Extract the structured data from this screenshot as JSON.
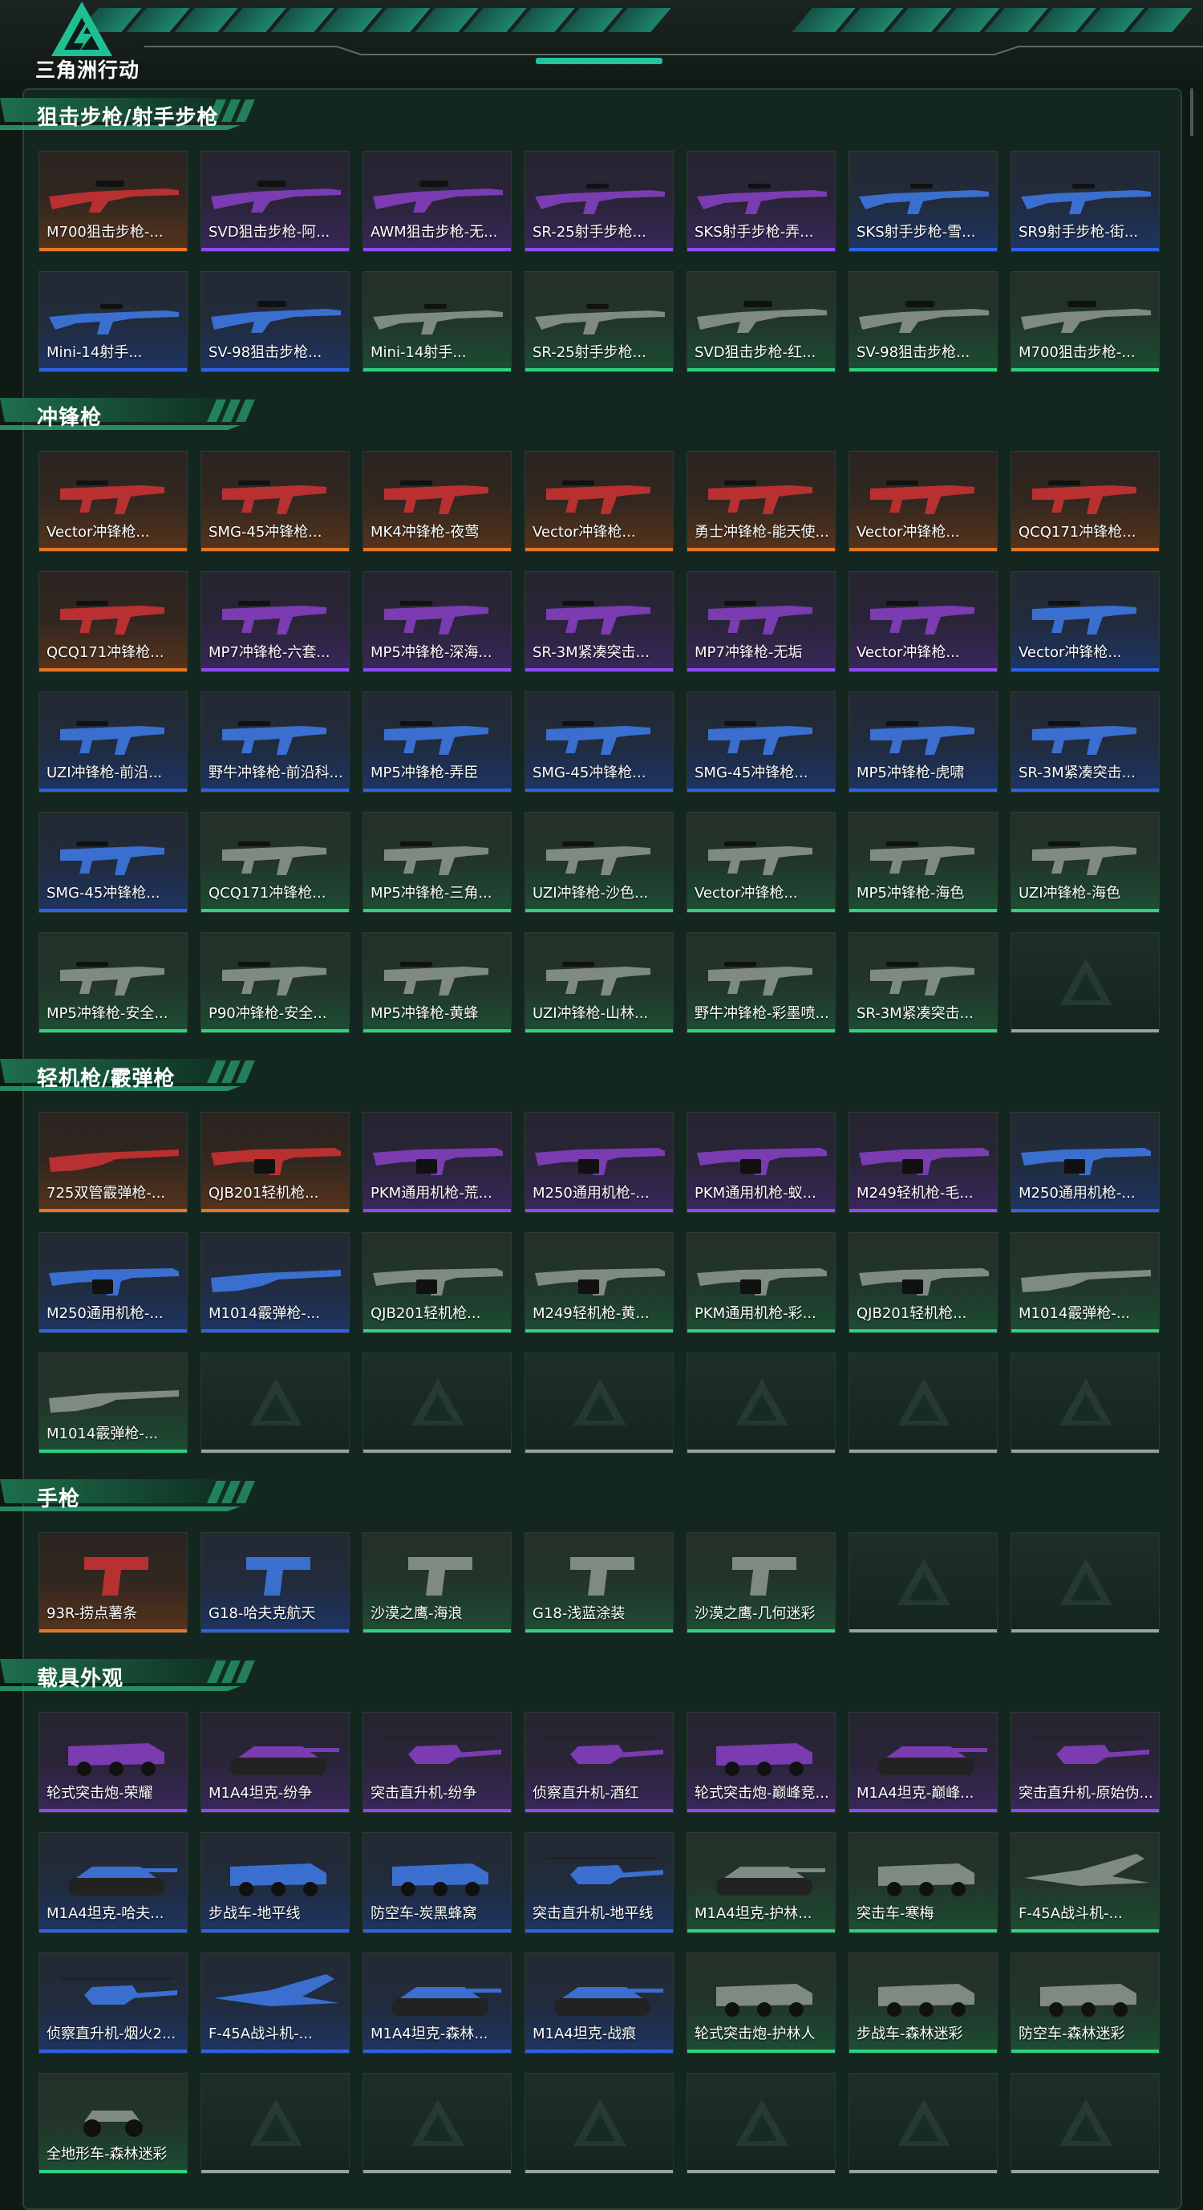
{
  "logo": {
    "text": "三角洲行动"
  },
  "colors": {
    "accent": "#24c39d",
    "orange": "#e57623",
    "purple": "#8a4cf0",
    "blue": "#2e62e6",
    "green": "#2ed27e",
    "empty": "#9aa29e"
  },
  "sections": [
    {
      "title": "狙击步枪/射手步枪",
      "items": [
        {
          "label": "M700狙击步枪-...",
          "rarity": "orange",
          "icon": "sniper-rifle-icon"
        },
        {
          "label": "SVD狙击步枪-阿...",
          "rarity": "purple",
          "icon": "sniper-rifle-icon"
        },
        {
          "label": "AWM狙击步枪-无...",
          "rarity": "purple",
          "icon": "sniper-rifle-icon"
        },
        {
          "label": "SR-25射手步枪...",
          "rarity": "purple",
          "icon": "marksman-rifle-icon"
        },
        {
          "label": "SKS射手步枪-弄...",
          "rarity": "purple",
          "icon": "marksman-rifle-icon"
        },
        {
          "label": "SKS射手步枪-雪...",
          "rarity": "blue",
          "icon": "marksman-rifle-icon"
        },
        {
          "label": "SR9射手步枪-街...",
          "rarity": "blue",
          "icon": "marksman-rifle-icon"
        },
        {
          "label": "Mini-14射手...",
          "rarity": "blue",
          "icon": "marksman-rifle-icon"
        },
        {
          "label": "SV-98狙击步枪...",
          "rarity": "blue",
          "icon": "sniper-rifle-icon"
        },
        {
          "label": "Mini-14射手...",
          "rarity": "green",
          "icon": "marksman-rifle-icon"
        },
        {
          "label": "SR-25射手步枪...",
          "rarity": "green",
          "icon": "marksman-rifle-icon"
        },
        {
          "label": "SVD狙击步枪-红...",
          "rarity": "green",
          "icon": "sniper-rifle-icon"
        },
        {
          "label": "SV-98狙击步枪...",
          "rarity": "green",
          "icon": "sniper-rifle-icon"
        },
        {
          "label": "M700狙击步枪-...",
          "rarity": "green",
          "icon": "sniper-rifle-icon"
        }
      ]
    },
    {
      "title": "冲锋枪",
      "items": [
        {
          "label": "Vector冲锋枪...",
          "rarity": "orange",
          "icon": "smg-icon"
        },
        {
          "label": "SMG-45冲锋枪...",
          "rarity": "orange",
          "icon": "smg-icon"
        },
        {
          "label": "MK4冲锋枪-夜莺",
          "rarity": "orange",
          "icon": "smg-icon"
        },
        {
          "label": "Vector冲锋枪...",
          "rarity": "orange",
          "icon": "smg-icon"
        },
        {
          "label": "勇士冲锋枪-能天使...",
          "rarity": "orange",
          "icon": "smg-icon"
        },
        {
          "label": "Vector冲锋枪...",
          "rarity": "orange",
          "icon": "smg-icon"
        },
        {
          "label": "QCQ171冲锋枪...",
          "rarity": "orange",
          "icon": "smg-icon"
        },
        {
          "label": "QCQ171冲锋枪...",
          "rarity": "orange",
          "icon": "smg-icon"
        },
        {
          "label": "MP7冲锋枪-六套...",
          "rarity": "purple",
          "icon": "smg-icon"
        },
        {
          "label": "MP5冲锋枪-深海...",
          "rarity": "purple",
          "icon": "smg-icon"
        },
        {
          "label": "SR-3M紧凑突击...",
          "rarity": "purple",
          "icon": "smg-icon"
        },
        {
          "label": "MP7冲锋枪-无垢",
          "rarity": "purple",
          "icon": "smg-icon"
        },
        {
          "label": "Vector冲锋枪...",
          "rarity": "purple",
          "icon": "smg-icon"
        },
        {
          "label": "Vector冲锋枪...",
          "rarity": "blue",
          "icon": "smg-icon"
        },
        {
          "label": "UZI冲锋枪-前沿...",
          "rarity": "blue",
          "icon": "smg-icon"
        },
        {
          "label": "野牛冲锋枪-前沿科...",
          "rarity": "blue",
          "icon": "smg-icon"
        },
        {
          "label": "MP5冲锋枪-弄臣",
          "rarity": "blue",
          "icon": "smg-icon"
        },
        {
          "label": "SMG-45冲锋枪...",
          "rarity": "blue",
          "icon": "smg-icon"
        },
        {
          "label": "SMG-45冲锋枪...",
          "rarity": "blue",
          "icon": "smg-icon"
        },
        {
          "label": "MP5冲锋枪-虎啸",
          "rarity": "blue",
          "icon": "smg-icon"
        },
        {
          "label": "SR-3M紧凑突击...",
          "rarity": "blue",
          "icon": "smg-icon"
        },
        {
          "label": "SMG-45冲锋枪...",
          "rarity": "blue",
          "icon": "smg-icon"
        },
        {
          "label": "QCQ171冲锋枪...",
          "rarity": "green",
          "icon": "smg-icon"
        },
        {
          "label": "MP5冲锋枪-三角...",
          "rarity": "green",
          "icon": "smg-icon"
        },
        {
          "label": "UZI冲锋枪-沙色...",
          "rarity": "green",
          "icon": "smg-icon"
        },
        {
          "label": "Vector冲锋枪...",
          "rarity": "green",
          "icon": "smg-icon"
        },
        {
          "label": "MP5冲锋枪-海色",
          "rarity": "green",
          "icon": "smg-icon"
        },
        {
          "label": "UZI冲锋枪-海色",
          "rarity": "green",
          "icon": "smg-icon"
        },
        {
          "label": "MP5冲锋枪-安全...",
          "rarity": "green",
          "icon": "smg-icon"
        },
        {
          "label": "P90冲锋枪-安全...",
          "rarity": "green",
          "icon": "smg-icon"
        },
        {
          "label": "MP5冲锋枪-黄蜂",
          "rarity": "green",
          "icon": "smg-icon"
        },
        {
          "label": "UZI冲锋枪-山林...",
          "rarity": "green",
          "icon": "smg-icon"
        },
        {
          "label": "野牛冲锋枪-彩墨喷...",
          "rarity": "green",
          "icon": "smg-icon"
        },
        {
          "label": "SR-3M紧凑突击...",
          "rarity": "green",
          "icon": "smg-icon"
        },
        {
          "label": "",
          "rarity": "empty",
          "icon": ""
        }
      ]
    },
    {
      "title": "轻机枪/霰弹枪",
      "items": [
        {
          "label": "725双管霰弹枪-...",
          "rarity": "orange",
          "icon": "shotgun-icon"
        },
        {
          "label": "QJB201轻机枪...",
          "rarity": "orange",
          "icon": "lmg-icon"
        },
        {
          "label": "PKM通用机枪-荒...",
          "rarity": "purple",
          "icon": "lmg-icon"
        },
        {
          "label": "M250通用机枪-...",
          "rarity": "purple",
          "icon": "lmg-icon"
        },
        {
          "label": "PKM通用机枪-蚁...",
          "rarity": "purple",
          "icon": "lmg-icon"
        },
        {
          "label": "M249轻机枪-毛...",
          "rarity": "purple",
          "icon": "lmg-icon"
        },
        {
          "label": "M250通用机枪-...",
          "rarity": "blue",
          "icon": "lmg-icon"
        },
        {
          "label": "M250通用机枪-...",
          "rarity": "blue",
          "icon": "lmg-icon"
        },
        {
          "label": "M1014霰弹枪-...",
          "rarity": "blue",
          "icon": "shotgun-icon"
        },
        {
          "label": "QJB201轻机枪...",
          "rarity": "green",
          "icon": "lmg-icon"
        },
        {
          "label": "M249轻机枪-黄...",
          "rarity": "green",
          "icon": "lmg-icon"
        },
        {
          "label": "PKM通用机枪-彩...",
          "rarity": "green",
          "icon": "lmg-icon"
        },
        {
          "label": "QJB201轻机枪...",
          "rarity": "green",
          "icon": "lmg-icon"
        },
        {
          "label": "M1014霰弹枪-...",
          "rarity": "green",
          "icon": "shotgun-icon"
        },
        {
          "label": "M1014霰弹枪-...",
          "rarity": "green",
          "icon": "shotgun-icon"
        },
        {
          "label": "",
          "rarity": "empty",
          "icon": ""
        },
        {
          "label": "",
          "rarity": "empty",
          "icon": ""
        },
        {
          "label": "",
          "rarity": "empty",
          "icon": ""
        },
        {
          "label": "",
          "rarity": "empty",
          "icon": ""
        },
        {
          "label": "",
          "rarity": "empty",
          "icon": ""
        },
        {
          "label": "",
          "rarity": "empty",
          "icon": ""
        }
      ]
    },
    {
      "title": "手枪",
      "items": [
        {
          "label": "93R-捞点薯条",
          "rarity": "orange",
          "icon": "pistol-icon"
        },
        {
          "label": "G18-哈夫克航天",
          "rarity": "blue",
          "icon": "pistol-icon"
        },
        {
          "label": "沙漠之鹰-海浪",
          "rarity": "green",
          "icon": "pistol-icon"
        },
        {
          "label": "G18-浅蓝涂装",
          "rarity": "green",
          "icon": "pistol-icon"
        },
        {
          "label": "沙漠之鹰-几何迷彩",
          "rarity": "green",
          "icon": "pistol-icon"
        },
        {
          "label": "",
          "rarity": "empty",
          "icon": ""
        },
        {
          "label": "",
          "rarity": "empty",
          "icon": ""
        }
      ]
    },
    {
      "title": "载具外观",
      "items": [
        {
          "label": "轮式突击炮-荣耀",
          "rarity": "purple",
          "icon": "wheeled-vehicle-icon"
        },
        {
          "label": "M1A4坦克-纷争",
          "rarity": "purple",
          "icon": "tank-icon"
        },
        {
          "label": "突击直升机-纷争",
          "rarity": "purple",
          "icon": "helicopter-icon"
        },
        {
          "label": "侦察直升机-酒红",
          "rarity": "purple",
          "icon": "helicopter-icon"
        },
        {
          "label": "轮式突击炮-巅峰竞...",
          "rarity": "purple",
          "icon": "wheeled-vehicle-icon"
        },
        {
          "label": "M1A4坦克-巅峰...",
          "rarity": "purple",
          "icon": "tank-icon"
        },
        {
          "label": "突击直升机-原始伪...",
          "rarity": "purple",
          "icon": "helicopter-icon"
        },
        {
          "label": "M1A4坦克-哈夫...",
          "rarity": "blue",
          "icon": "tank-icon"
        },
        {
          "label": "步战车-地平线",
          "rarity": "blue",
          "icon": "wheeled-vehicle-icon"
        },
        {
          "label": "防空车-炭黑蜂窝",
          "rarity": "blue",
          "icon": "wheeled-vehicle-icon"
        },
        {
          "label": "突击直升机-地平线",
          "rarity": "blue",
          "icon": "helicopter-icon"
        },
        {
          "label": "M1A4坦克-护林...",
          "rarity": "green",
          "icon": "tank-icon"
        },
        {
          "label": "突击车-寒梅",
          "rarity": "green",
          "icon": "wheeled-vehicle-icon"
        },
        {
          "label": "F-45A战斗机-...",
          "rarity": "green",
          "icon": "jet-icon"
        },
        {
          "label": "侦察直升机-烟火2...",
          "rarity": "blue",
          "icon": "helicopter-icon"
        },
        {
          "label": "F-45A战斗机-...",
          "rarity": "blue",
          "icon": "jet-icon"
        },
        {
          "label": "M1A4坦克-森林...",
          "rarity": "blue",
          "icon": "tank-icon"
        },
        {
          "label": "M1A4坦克-战痕",
          "rarity": "blue",
          "icon": "tank-icon"
        },
        {
          "label": "轮式突击炮-护林人",
          "rarity": "green",
          "icon": "wheeled-vehicle-icon"
        },
        {
          "label": "步战车-森林迷彩",
          "rarity": "green",
          "icon": "wheeled-vehicle-icon"
        },
        {
          "label": "防空车-森林迷彩",
          "rarity": "green",
          "icon": "wheeled-vehicle-icon"
        },
        {
          "label": "全地形车-森林迷彩",
          "rarity": "green",
          "icon": "atv-icon"
        },
        {
          "label": "",
          "rarity": "empty",
          "icon": ""
        },
        {
          "label": "",
          "rarity": "empty",
          "icon": ""
        },
        {
          "label": "",
          "rarity": "empty",
          "icon": ""
        },
        {
          "label": "",
          "rarity": "empty",
          "icon": ""
        },
        {
          "label": "",
          "rarity": "empty",
          "icon": ""
        },
        {
          "label": "",
          "rarity": "empty",
          "icon": ""
        }
      ]
    }
  ]
}
